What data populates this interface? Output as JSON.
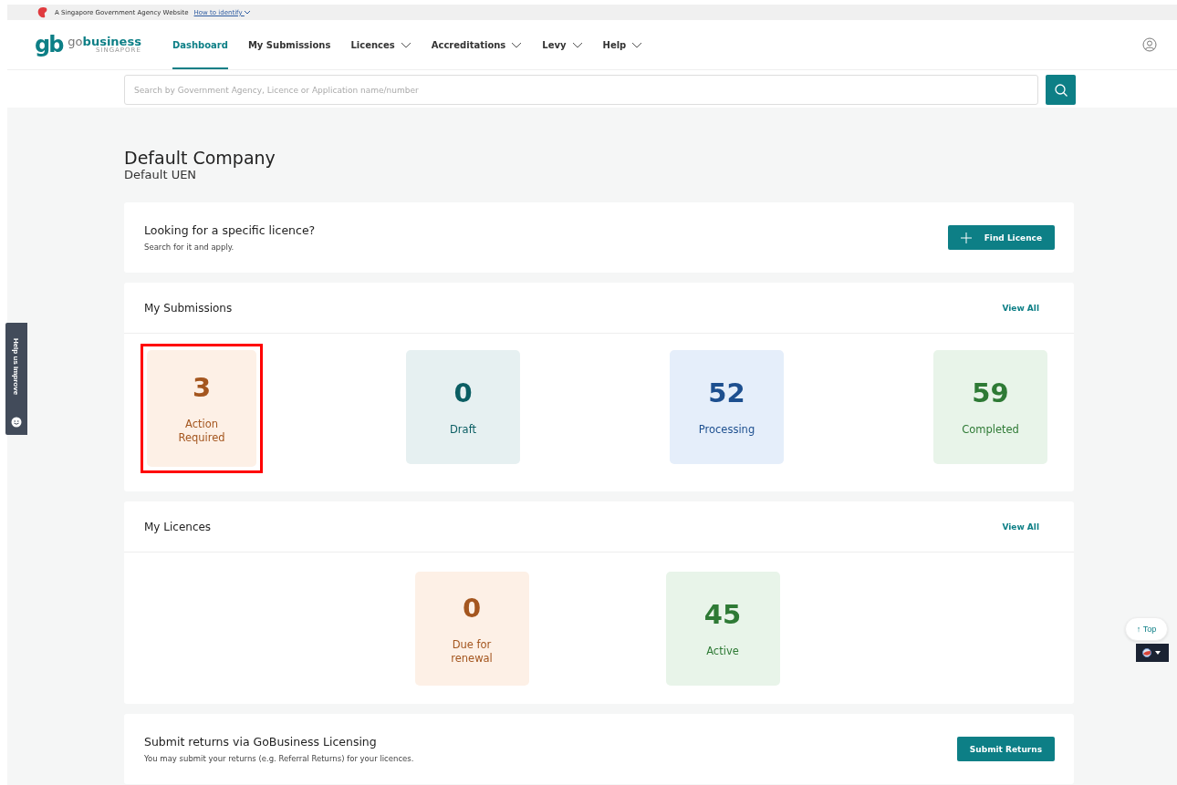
{
  "gov_banner": {
    "text": "A Singapore Government Agency Website",
    "link": "How to identify"
  },
  "logo": {
    "mark": "gb",
    "name_light": "go",
    "name_bold": "business",
    "sub": "SINGAPORE"
  },
  "nav": [
    {
      "label": "Dashboard",
      "selected": true,
      "dropdown": false
    },
    {
      "label": "My Submissions",
      "selected": false,
      "dropdown": false
    },
    {
      "label": "Licences",
      "selected": false,
      "dropdown": true
    },
    {
      "label": "Accreditations",
      "selected": false,
      "dropdown": true
    },
    {
      "label": "Levy",
      "selected": false,
      "dropdown": true
    },
    {
      "label": "Help",
      "selected": false,
      "dropdown": true
    }
  ],
  "search": {
    "placeholder": "Search by Government Agency, Licence or Application name/number"
  },
  "company": {
    "name": "Default Company",
    "uen": "Default UEN"
  },
  "find_licence": {
    "title": "Looking for a specific licence?",
    "subtitle": "Search for it and apply.",
    "button": "Find Licence"
  },
  "submissions": {
    "title": "My Submissions",
    "view_all": "View All",
    "tiles": [
      {
        "count": "3",
        "label": "Action Required",
        "kind": "action",
        "highlighted": true
      },
      {
        "count": "0",
        "label": "Draft",
        "kind": "draft",
        "highlighted": false
      },
      {
        "count": "52",
        "label": "Processing",
        "kind": "processing",
        "highlighted": false
      },
      {
        "count": "59",
        "label": "Completed",
        "kind": "completed",
        "highlighted": false
      }
    ]
  },
  "licences": {
    "title": "My Licences",
    "view_all": "View All",
    "tiles": [
      {
        "count": "0",
        "label": "Due for renewal",
        "kind": "action",
        "highlighted": false
      },
      {
        "count": "45",
        "label": "Active",
        "kind": "completed",
        "highlighted": false
      }
    ]
  },
  "returns": {
    "title": "Submit returns via GoBusiness Licensing",
    "subtitle": "You may submit your returns (e.g. Referral Returns) for your licences.",
    "button": "Submit Returns"
  },
  "feedback_tab": {
    "label": "Help us improve"
  },
  "top_button": {
    "label": "Top",
    "arrow": "↑"
  }
}
